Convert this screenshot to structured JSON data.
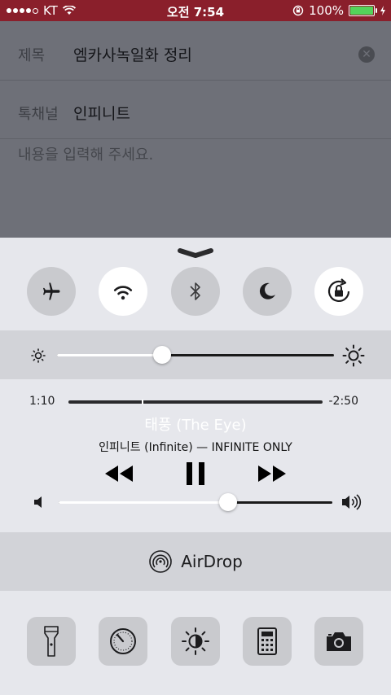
{
  "status_bar": {
    "carrier": "KT",
    "time": "오전 7:54",
    "battery": "100%",
    "battery_color": "#54d35a",
    "bar_color": "#8a1f2b"
  },
  "form": {
    "title_label": "제목",
    "title_value": "엠카사녹일화 정리",
    "channel_label": "톡채널",
    "channel_value": "인피니트",
    "content_placeholder": "내용을 입력해 주세요."
  },
  "control_center": {
    "toggles": [
      {
        "name": "airplane-mode",
        "icon": "airplane-icon",
        "on": false
      },
      {
        "name": "wifi",
        "icon": "wifi-icon",
        "on": true
      },
      {
        "name": "bluetooth",
        "icon": "bluetooth-icon",
        "on": false
      },
      {
        "name": "do-not-disturb",
        "icon": "moon-icon",
        "on": false
      },
      {
        "name": "rotation-lock",
        "icon": "rotation-lock-icon",
        "on": true
      }
    ],
    "brightness_level": 0.38,
    "music": {
      "elapsed": "1:10",
      "remaining": "-2:50",
      "progress": 0.29,
      "title": "태풍 (The Eye)",
      "artist_album": "인피니트 (Infinite) — INFINITE ONLY",
      "volume_level": 0.62
    },
    "airdrop_label": "AirDrop",
    "tools": [
      {
        "name": "flashlight",
        "icon": "flashlight-icon"
      },
      {
        "name": "timer",
        "icon": "timer-icon"
      },
      {
        "name": "night-shift",
        "icon": "night-shift-icon"
      },
      {
        "name": "calculator",
        "icon": "calculator-icon"
      },
      {
        "name": "camera",
        "icon": "camera-icon"
      }
    ]
  }
}
